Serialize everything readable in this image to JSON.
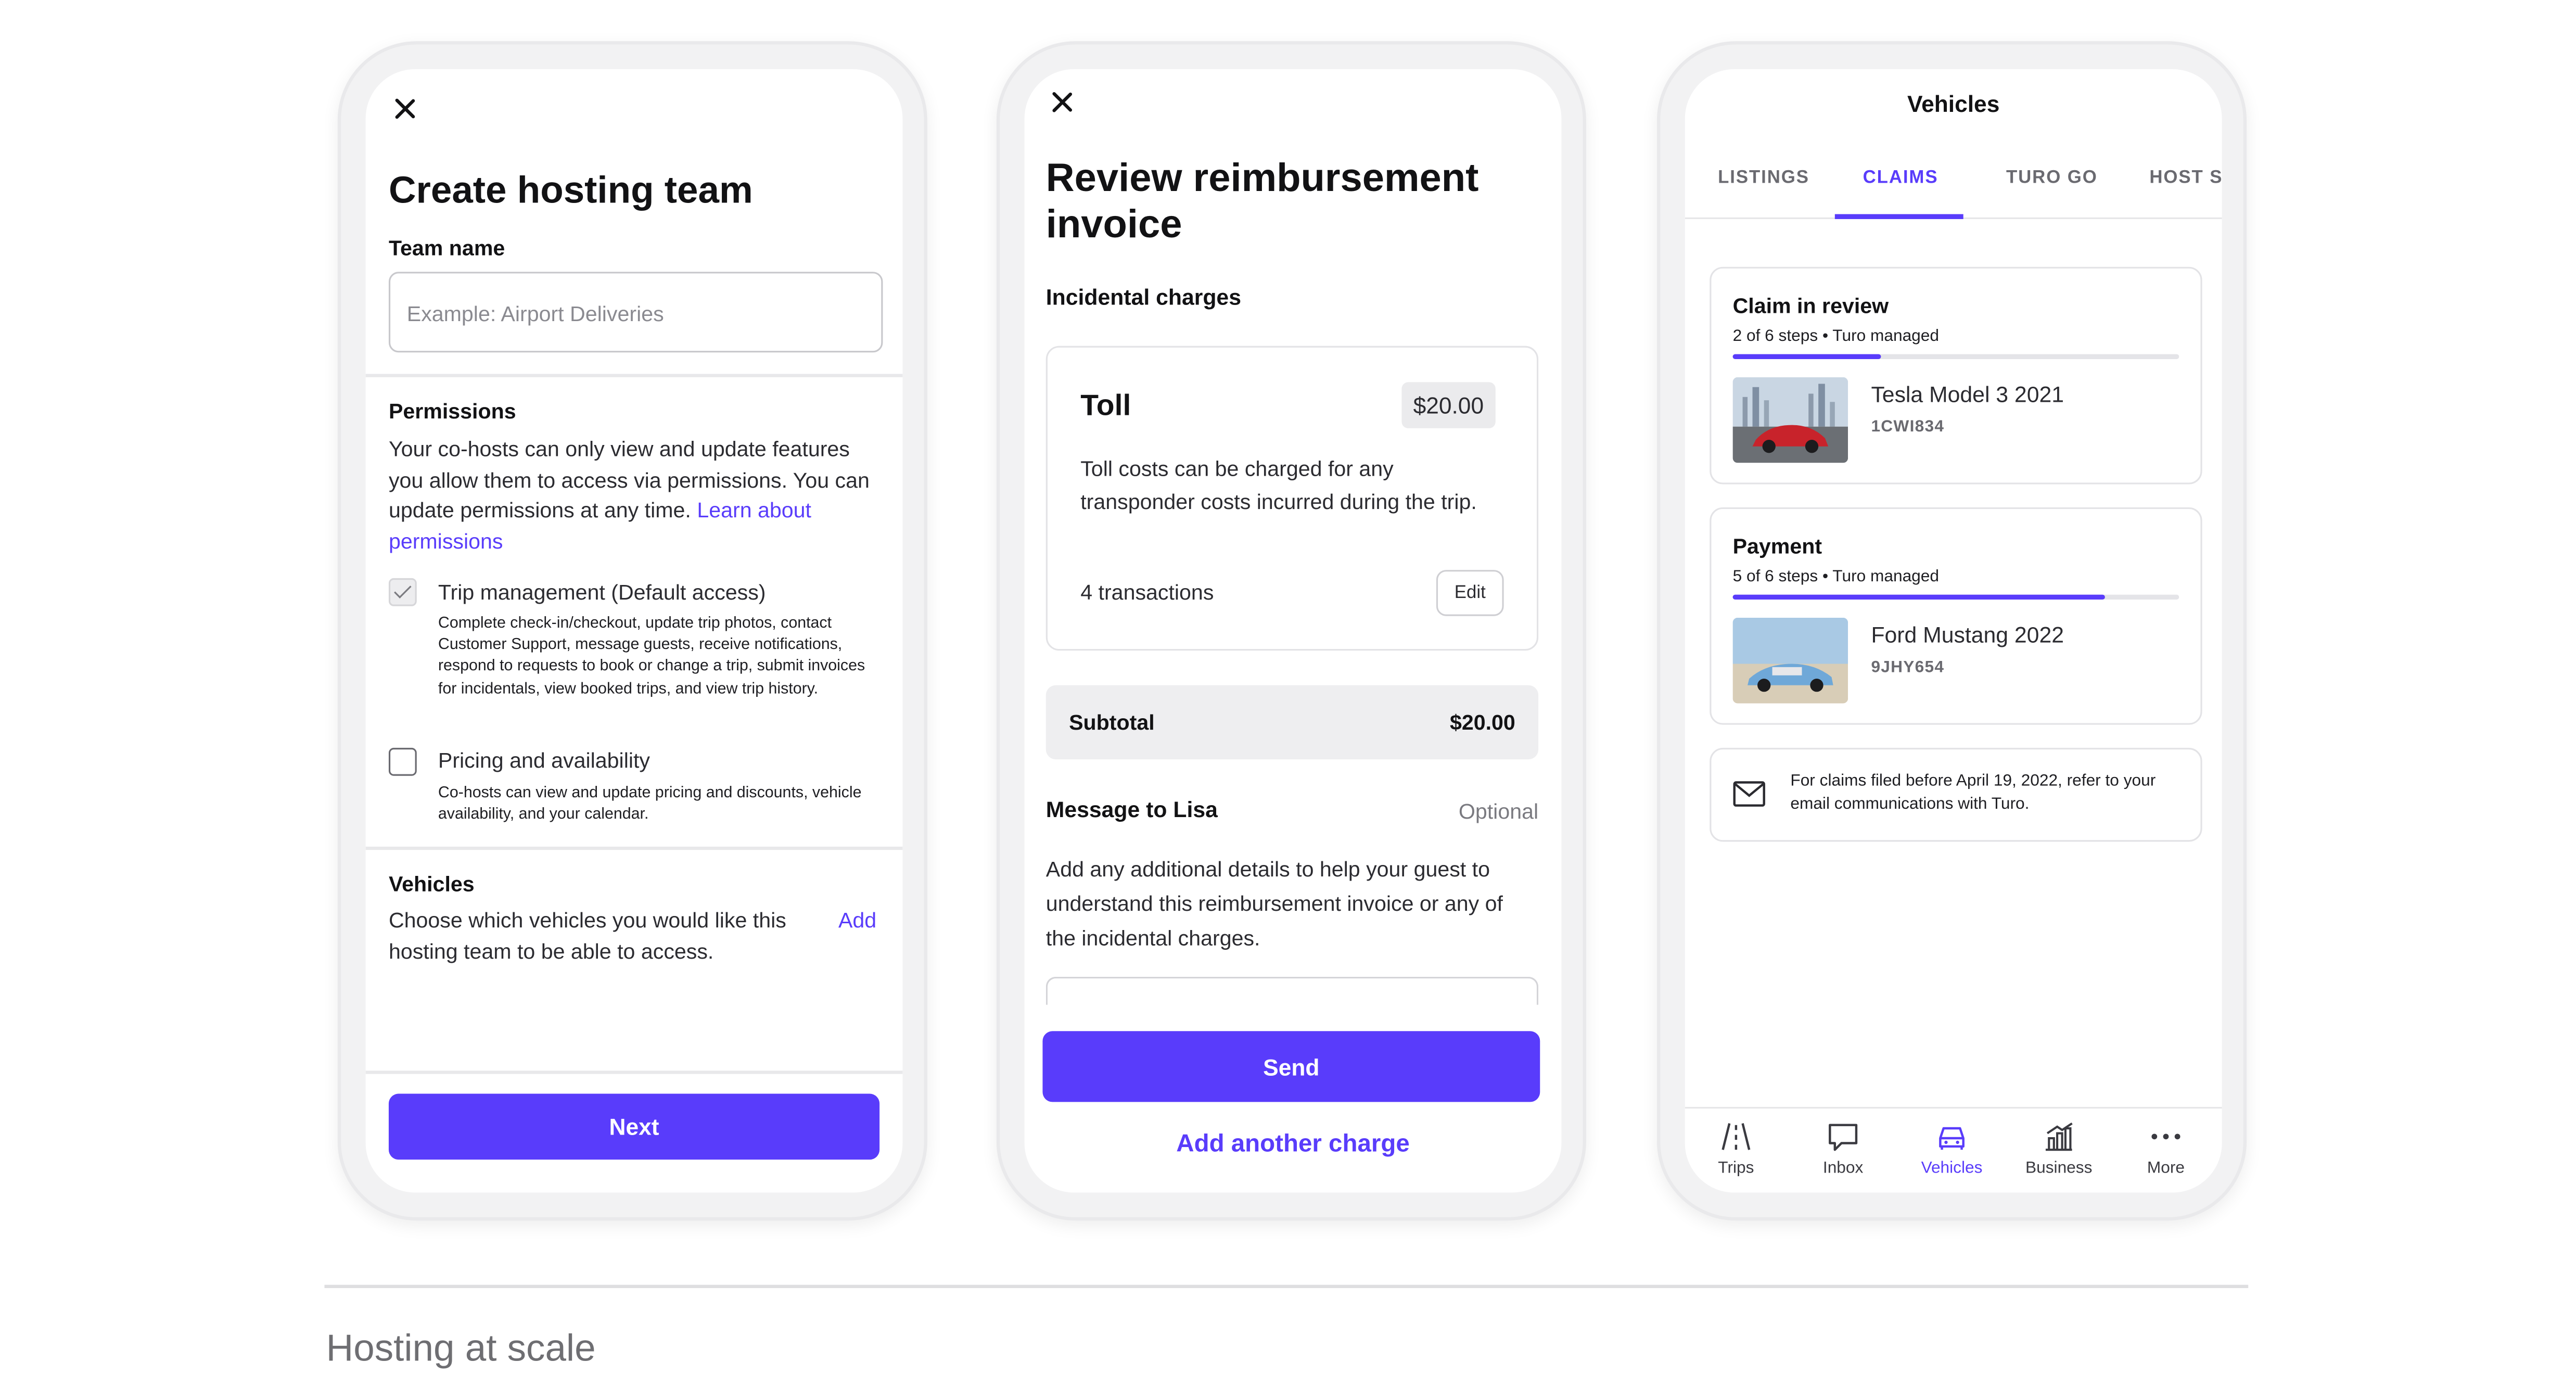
{
  "colors": {
    "accent": "#593cfb",
    "text": "#121214",
    "muted": "#6a6a70"
  },
  "phone1": {
    "close_icon": "close-icon",
    "title": "Create hosting team",
    "team_name_label": "Team name",
    "team_name_placeholder": "Example: Airport Deliveries",
    "permissions_title": "Permissions",
    "permissions_body": "Your co-hosts can only view and update features you allow them to access via permissions. You can update permissions at any time.",
    "permissions_link": "Learn about permissions",
    "option1": {
      "label": "Trip management (Default access)",
      "checked": true,
      "desc": "Complete check-in/checkout, update trip photos, contact Customer Support, message guests, receive notifications, respond to requests to book or change a trip, submit invoices for incidentals, view booked trips, and view trip history."
    },
    "option2": {
      "label": "Pricing and availability",
      "checked": false,
      "desc": "Co-hosts can view and update pricing and discounts, vehicle availability, and your calendar."
    },
    "vehicles_title": "Vehicles",
    "vehicles_body": "Choose which vehicles you would like this hosting team to be able to access.",
    "vehicles_add": "Add",
    "next_label": "Next"
  },
  "phone2": {
    "close_icon": "close-icon",
    "title": "Review reimbursement invoice",
    "section": "Incidental charges",
    "charge": {
      "title": "Toll",
      "price": "$20.00",
      "desc": "Toll costs can be charged for any transponder costs incurred during the trip.",
      "transactions": "4 transactions",
      "edit": "Edit"
    },
    "subtotal_label": "Subtotal",
    "subtotal_value": "$20.00",
    "message_label": "Message to Lisa",
    "message_optional": "Optional",
    "message_help": "Add any additional details to help your guest to understand this reimbursement invoice or any of the incidental charges.",
    "send_label": "Send",
    "add_charge_label": "Add another charge"
  },
  "phone3": {
    "title": "Vehicles",
    "tabs": [
      {
        "label": "LISTINGS",
        "active": false
      },
      {
        "label": "CLAIMS",
        "active": true
      },
      {
        "label": "TURO GO",
        "active": false
      },
      {
        "label": "HOST SE",
        "active": false
      }
    ],
    "claims": [
      {
        "title": "Claim in review",
        "steps": "2 of 6 steps • Turo managed",
        "progress": 0.333,
        "car": "Tesla Model 3 2021",
        "plate": "1CWI834"
      },
      {
        "title": "Payment",
        "steps": "5 of 6 steps • Turo managed",
        "progress": 0.833,
        "car": "Ford Mustang 2022",
        "plate": "9JHY654"
      }
    ],
    "notice": "For claims filed before April 19, 2022, refer to your email communications with Turo.",
    "tabbar": [
      {
        "label": "Trips",
        "icon": "road-icon",
        "active": false
      },
      {
        "label": "Inbox",
        "icon": "chat-icon",
        "active": false
      },
      {
        "label": "Vehicles",
        "icon": "car-icon",
        "active": true
      },
      {
        "label": "Business",
        "icon": "chart-icon",
        "active": false
      },
      {
        "label": "More",
        "icon": "more-icon",
        "active": false
      }
    ]
  },
  "footer": {
    "title": "Hosting at scale"
  }
}
